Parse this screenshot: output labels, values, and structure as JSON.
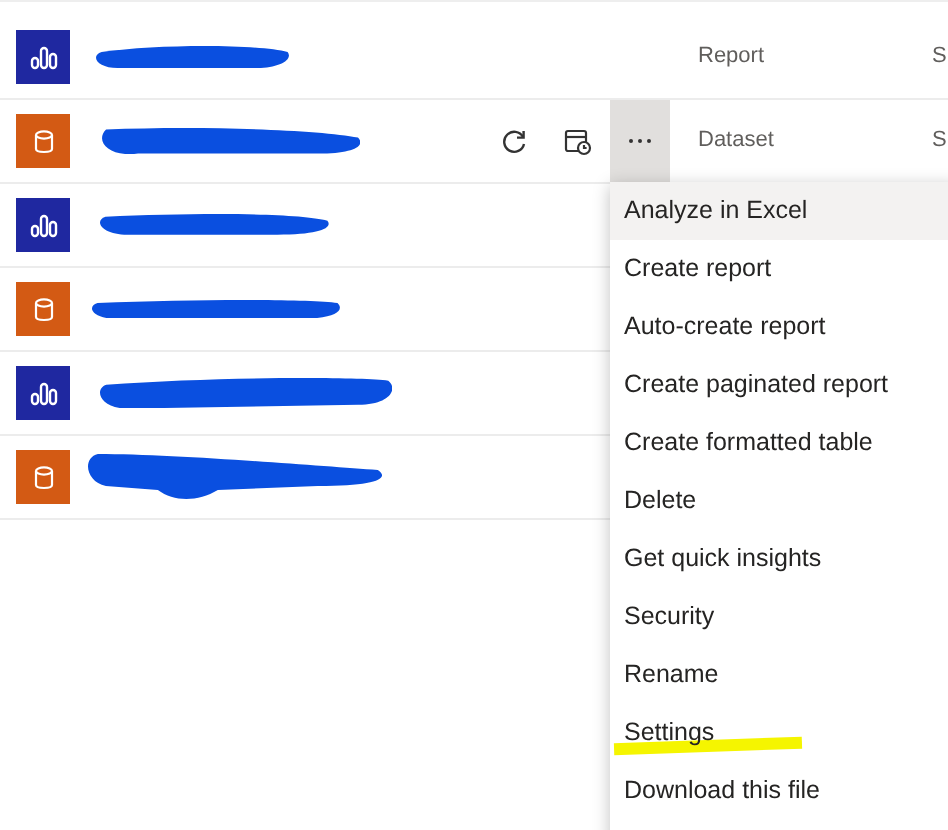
{
  "rows": [
    {
      "kind": "report",
      "type": "Report",
      "column_3": "S",
      "actions": false,
      "menu_open": false
    },
    {
      "kind": "dataset",
      "type": "Dataset",
      "column_3": "S",
      "actions": true,
      "menu_open": true
    },
    {
      "kind": "report",
      "actions": false,
      "menu_open": false
    },
    {
      "kind": "dataset",
      "actions": false,
      "menu_open": false
    },
    {
      "kind": "report",
      "actions": false,
      "menu_open": false
    },
    {
      "kind": "dataset",
      "actions": false,
      "menu_open": false
    }
  ],
  "context_menu": {
    "items": [
      {
        "label": "Analyze in Excel",
        "selected": true,
        "highlighted": false
      },
      {
        "label": "Create report",
        "selected": false,
        "highlighted": false
      },
      {
        "label": "Auto-create report",
        "selected": false,
        "highlighted": false
      },
      {
        "label": "Create paginated report",
        "selected": false,
        "highlighted": false
      },
      {
        "label": "Create formatted table",
        "selected": false,
        "highlighted": false
      },
      {
        "label": "Delete",
        "selected": false,
        "highlighted": false
      },
      {
        "label": "Get quick insights",
        "selected": false,
        "highlighted": false
      },
      {
        "label": "Security",
        "selected": false,
        "highlighted": false
      },
      {
        "label": "Rename",
        "selected": false,
        "highlighted": false
      },
      {
        "label": "Settings",
        "selected": false,
        "highlighted": true
      },
      {
        "label": "Download this file",
        "selected": false,
        "highlighted": false
      }
    ]
  }
}
